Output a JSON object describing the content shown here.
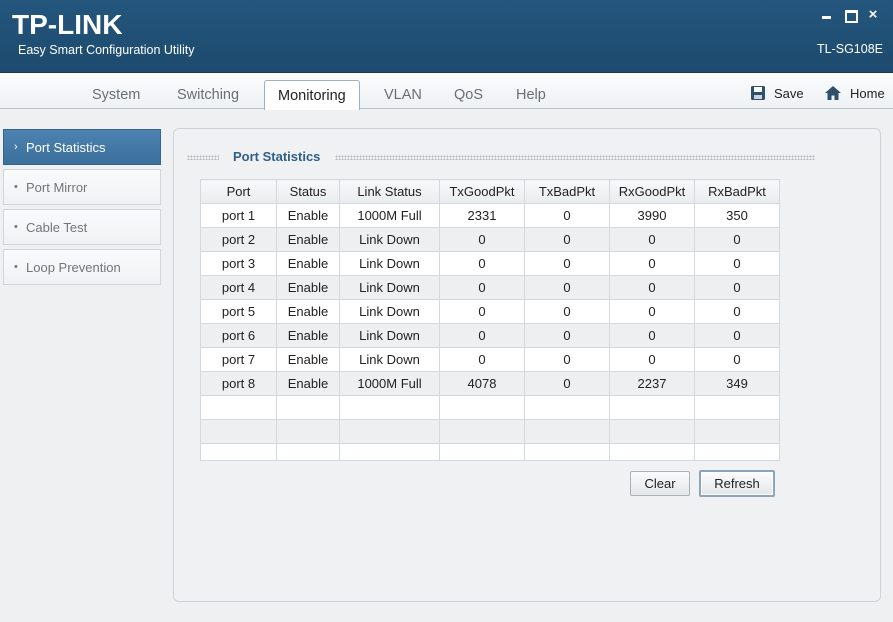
{
  "header": {
    "logo": "TP-LINK",
    "subtitle": "Easy Smart Configuration Utility",
    "model": "TL-SG108E",
    "close_glyph": "×"
  },
  "tabs": [
    {
      "label": "System"
    },
    {
      "label": "Switching"
    },
    {
      "label": "Monitoring",
      "active": true
    },
    {
      "label": "VLAN"
    },
    {
      "label": "QoS"
    },
    {
      "label": "Help"
    }
  ],
  "toolbar": {
    "save_label": "Save",
    "home_label": "Home",
    "save_icon": "floppy-disk-icon",
    "home_icon": "house-icon"
  },
  "sidebar": {
    "active_bullet": "›",
    "inactive_bullet": "•",
    "items": [
      {
        "label": "Port Statistics",
        "active": true
      },
      {
        "label": "Port Mirror"
      },
      {
        "label": "Cable Test"
      },
      {
        "label": "Loop Prevention"
      }
    ]
  },
  "section": {
    "title": "Port Statistics"
  },
  "table": {
    "headers": [
      "Port",
      "Status",
      "Link Status",
      "TxGoodPkt",
      "TxBadPkt",
      "RxGoodPkt",
      "RxBadPkt"
    ],
    "rows": [
      [
        "port 1",
        "Enable",
        "1000M Full",
        "2331",
        "0",
        "3990",
        "350"
      ],
      [
        "port 2",
        "Enable",
        "Link Down",
        "0",
        "0",
        "0",
        "0"
      ],
      [
        "port 3",
        "Enable",
        "Link Down",
        "0",
        "0",
        "0",
        "0"
      ],
      [
        "port 4",
        "Enable",
        "Link Down",
        "0",
        "0",
        "0",
        "0"
      ],
      [
        "port 5",
        "Enable",
        "Link Down",
        "0",
        "0",
        "0",
        "0"
      ],
      [
        "port 6",
        "Enable",
        "Link Down",
        "0",
        "0",
        "0",
        "0"
      ],
      [
        "port 7",
        "Enable",
        "Link Down",
        "0",
        "0",
        "0",
        "0"
      ],
      [
        "port 8",
        "Enable",
        "1000M Full",
        "4078",
        "0",
        "2237",
        "349"
      ]
    ]
  },
  "buttons": {
    "clear_label": "Clear",
    "refresh_label": "Refresh"
  },
  "colors": {
    "header_bg": "#24567d",
    "active_side": "#4279a6",
    "section_title": "#2f5f86"
  }
}
